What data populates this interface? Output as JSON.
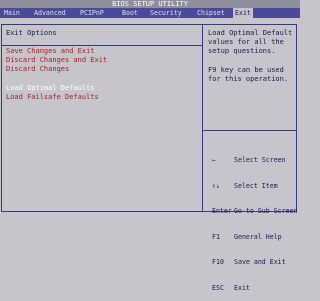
{
  "title": "BIOS SETUP UTILITY",
  "menu": [
    {
      "label": "Main"
    },
    {
      "label": "Advanced"
    },
    {
      "label": "PCIPnP"
    },
    {
      "label": "Boot"
    },
    {
      "label": "Security"
    },
    {
      "label": "Chipset"
    },
    {
      "label": "Exit"
    }
  ],
  "section_title": "Exit Options",
  "options": [
    {
      "label": "Save Changes and Exit"
    },
    {
      "label": "Discard Changes and Exit"
    },
    {
      "label": "Discard Changes"
    },
    {
      "label": "Load Optimal Defaults"
    },
    {
      "label": "Load Failsafe Defaults"
    }
  ],
  "help_text": {
    "line1": "Load Optimal Default",
    "line2": "values for all the",
    "line3": "setup questions.",
    "line4": "F9 key can be used",
    "line5": "for this operation."
  },
  "keys": [
    {
      "key": "←",
      "desc": "Select Screen"
    },
    {
      "key": "↑↓",
      "desc": "Select Item"
    },
    {
      "key": "Enter",
      "desc": "Go to Sub Screen"
    },
    {
      "key": "F1",
      "desc": "General Help"
    },
    {
      "key": "F10",
      "desc": "Save and Exit"
    },
    {
      "key": "ESC",
      "desc": "Exit"
    }
  ],
  "colors": {
    "background": "#c5c5cb",
    "menubar": "#4a4a98",
    "option_text": "#b01c1c",
    "selected_text": "#ffffff",
    "border": "#3a3a7a"
  }
}
